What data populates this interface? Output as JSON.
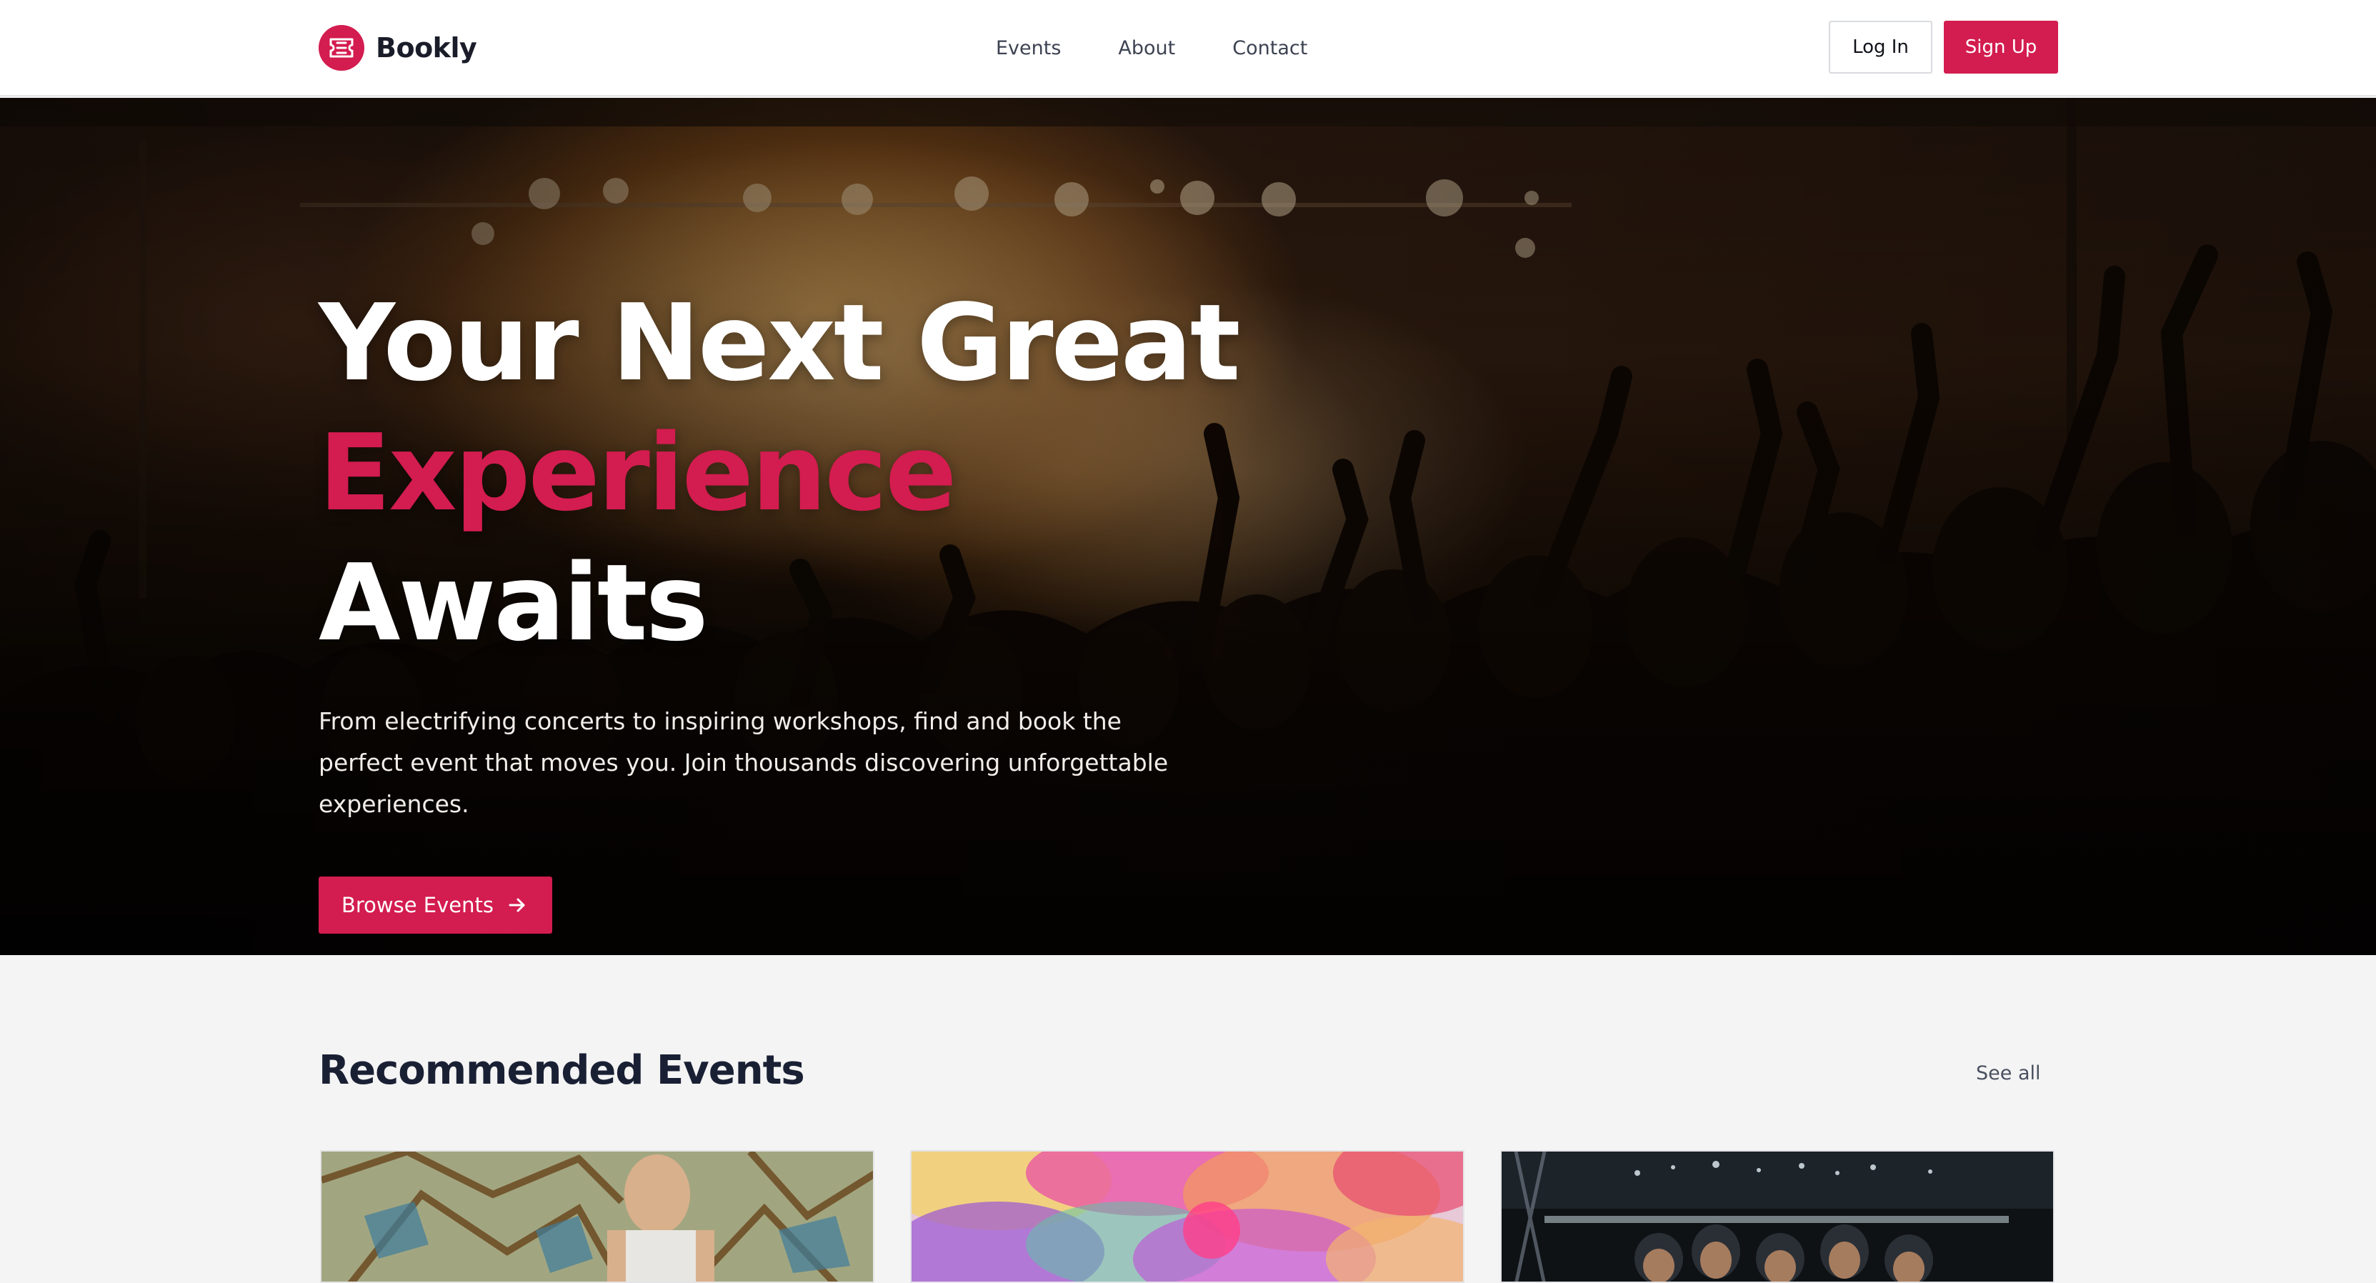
{
  "brand": {
    "name": "Bookly",
    "logo_icon": "ticket-icon",
    "accent": "#d31c4f"
  },
  "nav": {
    "links": [
      "Events",
      "About",
      "Contact"
    ],
    "login_label": "Log In",
    "signup_label": "Sign Up"
  },
  "hero": {
    "title_line1": "Your Next Great",
    "title_accent": "Experience",
    "title_rest": "Awaits",
    "subtitle": "From electrifying concerts to inspiring workshops, find and book the perfect event that moves you. Join thousands discovering unforgettable experiences.",
    "cta_label": "Browse Events",
    "cta_icon": "arrow-right-icon"
  },
  "recommended": {
    "title": "Recommended Events",
    "see_all_label": "See all"
  }
}
